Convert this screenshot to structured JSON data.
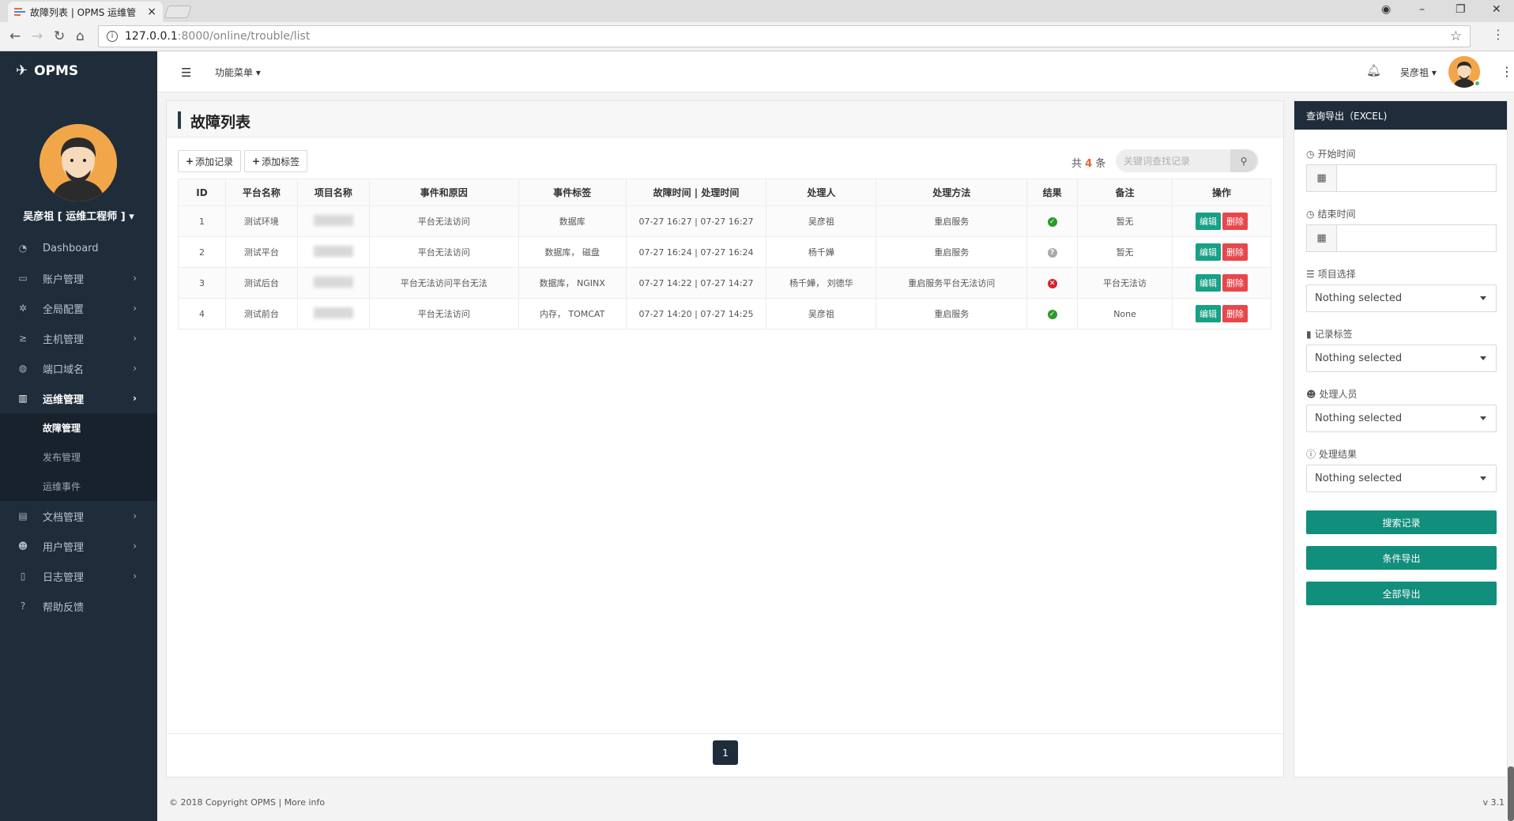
{
  "browser": {
    "tab_title": "故障列表 | OPMS 运维管",
    "tab_close": "×",
    "url_host": "127.0.0.1",
    "url_path": ":8000/online/trouble/list"
  },
  "sidebar": {
    "brand": "OPMS",
    "user": "吴彦祖 [ 运维工程师 ] ▾",
    "items": [
      {
        "icon": "dashboard-icon",
        "label": "Dashboard",
        "chevron": ""
      },
      {
        "icon": "desktop-icon",
        "label": "账户管理",
        "chevron": "›"
      },
      {
        "icon": "gear-icon",
        "label": "全局配置",
        "chevron": "›"
      },
      {
        "icon": "terminal-icon",
        "label": "主机管理",
        "chevron": "›"
      },
      {
        "icon": "globe-icon",
        "label": "端口域名",
        "chevron": "›"
      },
      {
        "icon": "bar-chart-icon",
        "label": "运维管理",
        "chevron": "›"
      },
      {
        "icon": "book-icon",
        "label": "文档管理",
        "chevron": "›"
      },
      {
        "icon": "users-icon",
        "label": "用户管理",
        "chevron": "›"
      },
      {
        "icon": "file-icon",
        "label": "日志管理",
        "chevron": "›"
      },
      {
        "icon": "question-icon",
        "label": "帮助反馈",
        "chevron": ""
      }
    ],
    "subitems": [
      "故障管理",
      "发布管理",
      "运维事件"
    ]
  },
  "topbar": {
    "func_menu": "功能菜单 ▾",
    "user": "吴彦祖 ▾"
  },
  "main": {
    "title": "故障列表",
    "add_record": "添加记录",
    "add_tag": "添加标签",
    "count_prefix": "共",
    "count": "4",
    "count_suffix": "条",
    "search_placeholder": "关键词查找记录",
    "columns": [
      "ID",
      "平台名称",
      "项目名称",
      "事件和原因",
      "事件标签",
      "故障时间 | 处理时间",
      "处理人",
      "处理方法",
      "结果",
      "备注",
      "操作"
    ],
    "rows": [
      {
        "id": "1",
        "platform": "测试环境",
        "cause": "平台无法访问",
        "tags": "数据库",
        "time": "07-27 16:27 | 07-27 16:27",
        "handler": "吴彦祖",
        "method": "重启服务",
        "result": "ok",
        "note": "暂无"
      },
      {
        "id": "2",
        "platform": "测试平台",
        "cause": "平台无法访问",
        "tags": "数据库， 磁盘",
        "time": "07-27 16:24 | 07-27 16:24",
        "handler": "杨千嬅",
        "method": "重启服务",
        "result": "pend",
        "note": "暂无"
      },
      {
        "id": "3",
        "platform": "测试后台",
        "cause": "平台无法访问平台无法",
        "tags": "数据库， NGINX",
        "time": "07-27 14:22 | 07-27 14:27",
        "handler": "杨千嬅， 刘德华",
        "method": "重启服务平台无法访问",
        "result": "fail",
        "note": "平台无法访"
      },
      {
        "id": "4",
        "platform": "测试前台",
        "cause": "平台无法访问",
        "tags": "内存， TOMCAT",
        "time": "07-27 14:20 | 07-27 14:25",
        "handler": "吴彦祖",
        "method": "重启服务",
        "result": "ok",
        "note": "None"
      }
    ],
    "edit_label": "编辑",
    "delete_label": "删除",
    "page": "1"
  },
  "right": {
    "header": "查询导出（EXCEL)",
    "start_label": "开始时间",
    "end_label": "结束时间",
    "project_label": "项目选择",
    "tag_label": "记录标签",
    "handler_label": "处理人员",
    "result_label": "处理结果",
    "nothing": "Nothing selected",
    "search_btn": "搜索记录",
    "cond_export": "条件导出",
    "all_export": "全部导出"
  },
  "footer": {
    "copyright": "© 2018 Copyright OPMS | More info",
    "version": "v 3.1"
  }
}
